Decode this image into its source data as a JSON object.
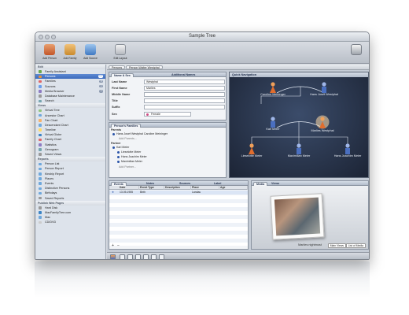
{
  "window": {
    "title": "Sample Tree"
  },
  "toolbar": {
    "add_person": "Add Person",
    "add_family": "Add Family",
    "add_source": "Add Source",
    "edit_layout": "Edit Layout"
  },
  "sidebar": {
    "sections": [
      {
        "title": "Edit",
        "items": [
          {
            "label": "Family Assistant",
            "count": "",
            "color": "#6aa84f"
          },
          {
            "label": "Persons",
            "count": "12",
            "color": "#e69138",
            "selected": true
          },
          {
            "label": "Families",
            "count": "5",
            "color": "#e06666"
          },
          {
            "label": "Sources",
            "count": "1",
            "color": "#6d9eeb"
          },
          {
            "label": "Media Browser",
            "count": "1",
            "color": "#8e7cc3"
          },
          {
            "label": "Database Maintenance",
            "count": "",
            "color": "#999999"
          },
          {
            "label": "Search",
            "count": "",
            "color": "#76a5af"
          }
        ]
      },
      {
        "title": "Views",
        "items": [
          {
            "label": "Virtual Tree",
            "count": "",
            "color": "#93c47d"
          },
          {
            "label": "Ancestor Chart",
            "count": "",
            "color": "#6fa8dc"
          },
          {
            "label": "Fan Chart",
            "count": "",
            "color": "#f6b26b"
          },
          {
            "label": "Descendant Chart",
            "count": "",
            "color": "#6fa8dc"
          },
          {
            "label": "Timeline",
            "count": "",
            "color": "#ffd966"
          },
          {
            "label": "Virtual Globe",
            "count": "",
            "color": "#3d85c6"
          },
          {
            "label": "Family Chart",
            "count": "",
            "color": "#e06666"
          },
          {
            "label": "Statistics",
            "count": "",
            "color": "#8e7cc3"
          },
          {
            "label": "Genogram",
            "count": "",
            "color": "#76a5af"
          },
          {
            "label": "Saved Views",
            "count": "",
            "color": "#999999"
          }
        ]
      },
      {
        "title": "Reports",
        "items": [
          {
            "label": "Person List",
            "count": "",
            "color": "#6fa8dc"
          },
          {
            "label": "Person Report",
            "count": "",
            "color": "#6fa8dc"
          },
          {
            "label": "Kinship Report",
            "count": "",
            "color": "#6fa8dc"
          },
          {
            "label": "Places",
            "count": "",
            "color": "#6fa8dc"
          },
          {
            "label": "Events",
            "count": "",
            "color": "#6fa8dc"
          },
          {
            "label": "Distinctive Persons",
            "count": "",
            "color": "#6fa8dc"
          },
          {
            "label": "Birthdays",
            "count": "",
            "color": "#6fa8dc"
          },
          {
            "label": "Saved Reports",
            "count": "",
            "color": "#999999"
          }
        ]
      },
      {
        "title": "Publish Web Pages",
        "items": [
          {
            "label": "Hard Disk",
            "count": "",
            "color": "#999999"
          },
          {
            "label": "MacFamilyTree.com",
            "count": "",
            "color": "#3d85c6"
          },
          {
            "label": "Mac",
            "count": "",
            "color": "#6fa8dc"
          },
          {
            "label": "CD/DVD",
            "count": "",
            "color": "#cccccc"
          }
        ]
      }
    ]
  },
  "breadcrumb": {
    "persons": "Persons",
    "current": "Person Walter Westphal"
  },
  "edit_panel": {
    "tab_name_sex": "Name & Sex",
    "tab_additional": "Additional Names",
    "last_name_label": "Last Name",
    "last_name": "Westphal",
    "first_name_label": "First Name",
    "first_name": "Marlies",
    "middle_name_label": "Middle Name",
    "middle_name": "",
    "title_label": "Title",
    "title": "",
    "suffix_label": "Suffix",
    "suffix": "",
    "sex_label": "Sex",
    "sex": "Female"
  },
  "families_panel": {
    "tab": "Person's Families",
    "parents_head": "Parents",
    "parents": "Hans Josef Westphal  Caroline Meininger",
    "add_parents": "Add Parents...",
    "partner_head": "Partner",
    "partner": "Karl Meier",
    "children": [
      "Lieselotte Meier",
      "Hans Joachim Meier",
      "Maximilian Meier"
    ],
    "add_partner": "Add Partner..."
  },
  "quick_nav": {
    "title": "Quick Navigation",
    "people": {
      "caroline": "Caroline Meininger",
      "hansjosef": "Hans Josef Westphal",
      "karl": "Karl Meier",
      "marlies": "Marlies Westphal",
      "lieselotte": "Lieselotte Meier",
      "maximilian": "Maximilian Meier",
      "hansjoachim": "Hans Joachim Meier"
    }
  },
  "events_panel": {
    "tabs": [
      "Events",
      "Notes",
      "Sources",
      "Label"
    ],
    "columns": [
      "Date",
      "Event Type",
      "Description",
      "Place",
      "Age"
    ],
    "rows": [
      {
        "date": "13.05.1955",
        "type": "Birth",
        "description": "",
        "place": "Landau",
        "age": ""
      }
    ]
  },
  "media_panel": {
    "tab": "Media",
    "tab2": "Views",
    "caption": "Marlies nightmost",
    "btn_views": "Main Views",
    "btn_list": "List of Media"
  }
}
